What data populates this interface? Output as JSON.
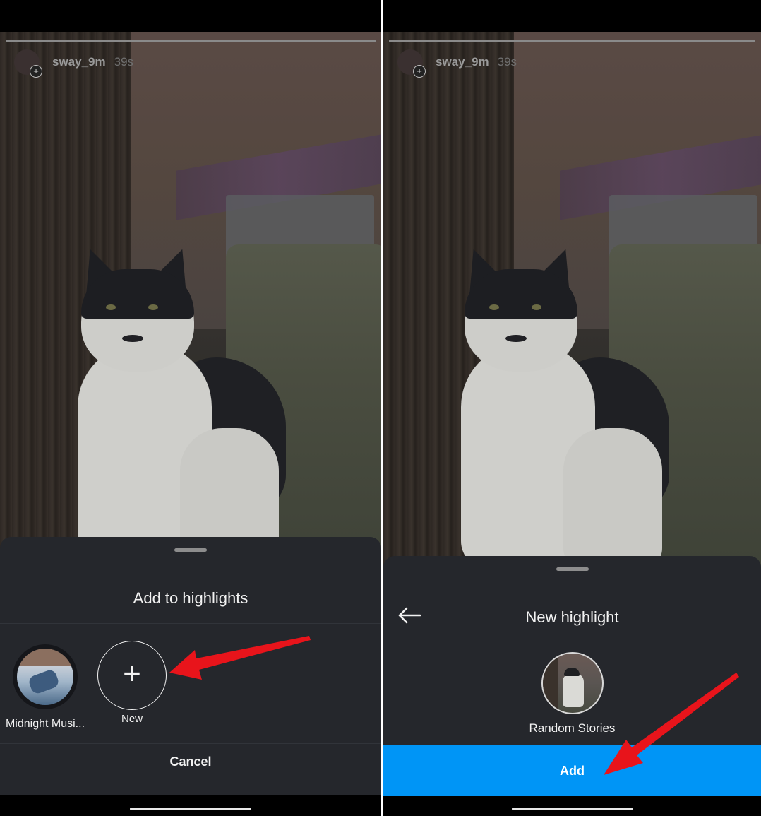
{
  "story": {
    "username": "sway_9m",
    "time": "39s"
  },
  "left_sheet": {
    "title": "Add to highlights",
    "highlights": [
      {
        "label": "Midnight Musi..."
      }
    ],
    "new_label": "New",
    "new_icon": "plus-icon",
    "cancel_label": "Cancel"
  },
  "right_sheet": {
    "title": "New highlight",
    "back_icon": "back-arrow-icon",
    "highlight_name": "Random Stories",
    "add_label": "Add"
  },
  "colors": {
    "sheet_bg": "#25272c",
    "add_button": "#0095f6",
    "annotation_arrow": "#e8141b"
  }
}
